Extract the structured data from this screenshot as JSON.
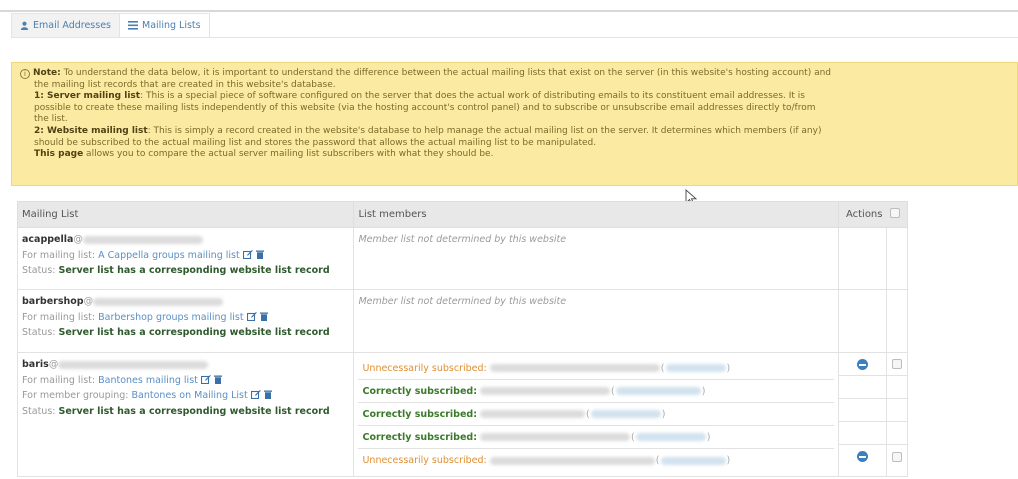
{
  "tabs": [
    {
      "label": "Email Addresses",
      "icon": "user-icon"
    },
    {
      "label": "Mailing Lists",
      "icon": "list-icon"
    }
  ],
  "note": {
    "lines": [
      {
        "bold": "Note:",
        "text": " To understand the data below, it is important to understand the difference between the actual mailing lists that exist on the server (in this website's hosting account) and"
      },
      {
        "bold": "",
        "text": "the mailing list records that are created in this website's database."
      },
      {
        "bold": "1: Server mailing list",
        "text": ": This is a special piece of software configured on the server that does the actual work of distributing emails to its constituent email addresses. It is"
      },
      {
        "bold": "",
        "text": "possible to create these mailing lists independently of this website (via the hosting account's control panel) and to subscribe or unsubscribe email addresses directly to/from"
      },
      {
        "bold": "",
        "text": "the list."
      },
      {
        "bold": "2: Website mailing list",
        "text": ": This is simply a record created in the website's database to help manage the actual mailing list on the server. It determines which members (if any)"
      },
      {
        "bold": "",
        "text": "should be subscribed to the actual mailing list and stores the password that allows the actual mailing list to be manipulated."
      },
      {
        "bold": "This page",
        "text": " allows you to compare the actual server mailing list subscribers with what they should be."
      }
    ]
  },
  "table": {
    "headers": {
      "list": "Mailing List",
      "members": "List members",
      "actions": "Actions"
    },
    "rows": [
      {
        "name": "acappella",
        "for_prefix": "For mailing list:",
        "for_link": "A Cappella groups mailing list",
        "status_prefix": "Status:",
        "status": "Server list has a corresponding website list record",
        "members_note": "Member list not determined by this website"
      },
      {
        "name": "barbershop",
        "for_prefix": "For mailing list:",
        "for_link": "Barbershop groups mailing list",
        "status_prefix": "Status:",
        "status": "Server list has a corresponding website list record",
        "members_note": "Member list not determined by this website"
      },
      {
        "name": "baris",
        "for_prefix": "For mailing list:",
        "for_link": "Bantones mailing list",
        "group_prefix": "For member grouping:",
        "group_link": "Bantones on Mailing List",
        "status_prefix": "Status:",
        "status": "Server list has a corresponding website list record",
        "members": [
          {
            "state": "Unnecessarily subscribed:",
            "kind": "unnec"
          },
          {
            "state": "Correctly subscribed:",
            "kind": "ok"
          },
          {
            "state": "Correctly subscribed:",
            "kind": "ok"
          },
          {
            "state": "Correctly subscribed:",
            "kind": "ok"
          },
          {
            "state": "Unnecessarily subscribed:",
            "kind": "unnec"
          }
        ]
      }
    ]
  },
  "colors": {
    "note_bg": "#fbeba2",
    "link": "#5b8fc4",
    "unnecessary": "#e08f30",
    "correct": "#3b7a2b",
    "action_blue": "#3a7fc0"
  }
}
